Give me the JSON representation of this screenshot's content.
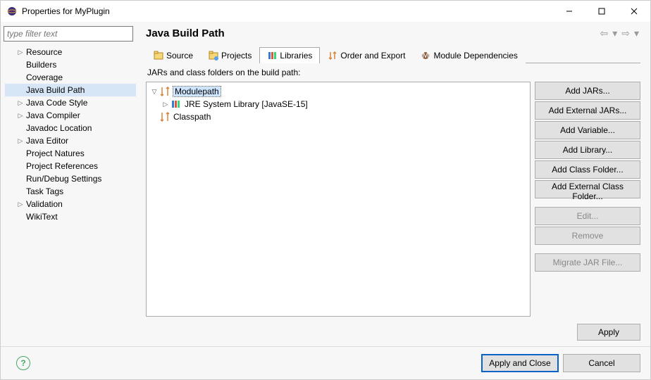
{
  "titlebar": {
    "title": "Properties for MyPlugin"
  },
  "filter": {
    "placeholder": "type filter text"
  },
  "sidebar": {
    "items": [
      {
        "label": "Resource",
        "expandable": true
      },
      {
        "label": "Builders",
        "expandable": false
      },
      {
        "label": "Coverage",
        "expandable": false
      },
      {
        "label": "Java Build Path",
        "expandable": false,
        "selected": true
      },
      {
        "label": "Java Code Style",
        "expandable": true
      },
      {
        "label": "Java Compiler",
        "expandable": true
      },
      {
        "label": "Javadoc Location",
        "expandable": false
      },
      {
        "label": "Java Editor",
        "expandable": true
      },
      {
        "label": "Project Natures",
        "expandable": false
      },
      {
        "label": "Project References",
        "expandable": false
      },
      {
        "label": "Run/Debug Settings",
        "expandable": false
      },
      {
        "label": "Task Tags",
        "expandable": false
      },
      {
        "label": "Validation",
        "expandable": true
      },
      {
        "label": "WikiText",
        "expandable": false
      }
    ]
  },
  "header": {
    "title": "Java Build Path"
  },
  "tabs": {
    "items": [
      {
        "label": "Source",
        "icon": "source"
      },
      {
        "label": "Projects",
        "icon": "projects"
      },
      {
        "label": "Libraries",
        "icon": "libraries",
        "active": true
      },
      {
        "label": "Order and Export",
        "icon": "order"
      },
      {
        "label": "Module Dependencies",
        "icon": "module"
      }
    ]
  },
  "description": "JARs and class folders on the build path:",
  "pathtree": {
    "items": [
      {
        "label": "Modulepath",
        "depth": 0,
        "expanded": true,
        "selected": true,
        "icon": "path"
      },
      {
        "label": "JRE System Library [JavaSE-15]",
        "depth": 1,
        "expanded": false,
        "icon": "jre"
      },
      {
        "label": "Classpath",
        "depth": 0,
        "expanded": false,
        "icon": "path",
        "expander": false
      }
    ]
  },
  "buttons": {
    "add_jars": "Add JARs...",
    "add_ext_jars": "Add External JARs...",
    "add_var": "Add Variable...",
    "add_lib": "Add Library...",
    "add_cf": "Add Class Folder...",
    "add_ext_cf": "Add External Class Folder...",
    "edit": "Edit...",
    "remove": "Remove",
    "migrate": "Migrate JAR File..."
  },
  "apply": "Apply",
  "footer": {
    "apply_close": "Apply and Close",
    "cancel": "Cancel"
  }
}
